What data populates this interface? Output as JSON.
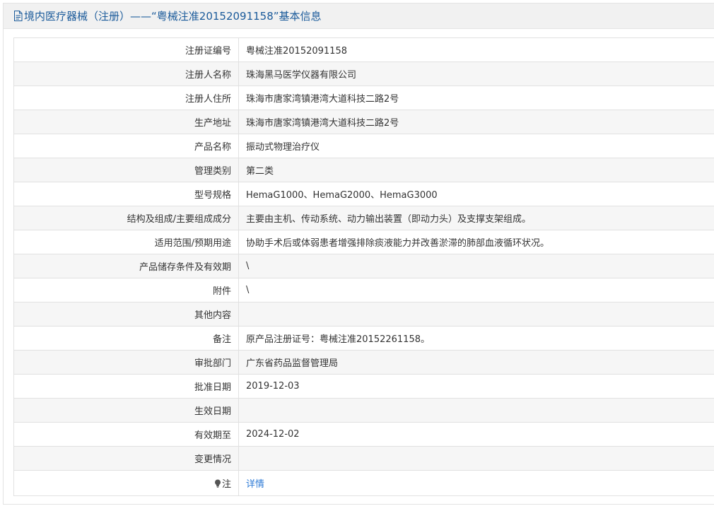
{
  "header": {
    "title": "境内医疗器械（注册）——“粤械注准20152091158”基本信息",
    "icon": "document-icon"
  },
  "rows": [
    {
      "label": "注册证编号",
      "value": "粤械注准20152091158"
    },
    {
      "label": "注册人名称",
      "value": "珠海黑马医学仪器有限公司"
    },
    {
      "label": "注册人住所",
      "value": "珠海市唐家湾镇港湾大道科技二路2号"
    },
    {
      "label": "生产地址",
      "value": "珠海市唐家湾镇港湾大道科技二路2号"
    },
    {
      "label": "产品名称",
      "value": "振动式物理治疗仪"
    },
    {
      "label": "管理类别",
      "value": "第二类"
    },
    {
      "label": "型号规格",
      "value": "HemaG1000、HemaG2000、HemaG3000"
    },
    {
      "label": "结构及组成/主要组成成分",
      "value": "主要由主机、传动系统、动力输出装置（即动力头）及支撑支架组成。"
    },
    {
      "label": "适用范围/预期用途",
      "value": "协助手术后或体弱患者增强排除痰液能力并改善淤滞的肺部血液循环状况。"
    },
    {
      "label": "产品储存条件及有效期",
      "value": "\\"
    },
    {
      "label": "附件",
      "value": "\\"
    },
    {
      "label": "其他内容",
      "value": ""
    },
    {
      "label": "备注",
      "value": "原产品注册证号：粤械注准20152261158。"
    },
    {
      "label": "审批部门",
      "value": "广东省药品监督管理局"
    },
    {
      "label": "批准日期",
      "value": "2019-12-03"
    },
    {
      "label": "生效日期",
      "value": ""
    },
    {
      "label": "有效期至",
      "value": "2024-12-02"
    },
    {
      "label": "变更情况",
      "value": ""
    }
  ],
  "note_row": {
    "label": "注",
    "icon": "lightbulb-icon",
    "link_text": "详情"
  },
  "colors": {
    "title": "#1a5a9a",
    "link": "#2d7ad6",
    "header_bg": "#f1f1f1",
    "stripe_bg": "#f6f6f6",
    "border": "#e1e1e1"
  }
}
